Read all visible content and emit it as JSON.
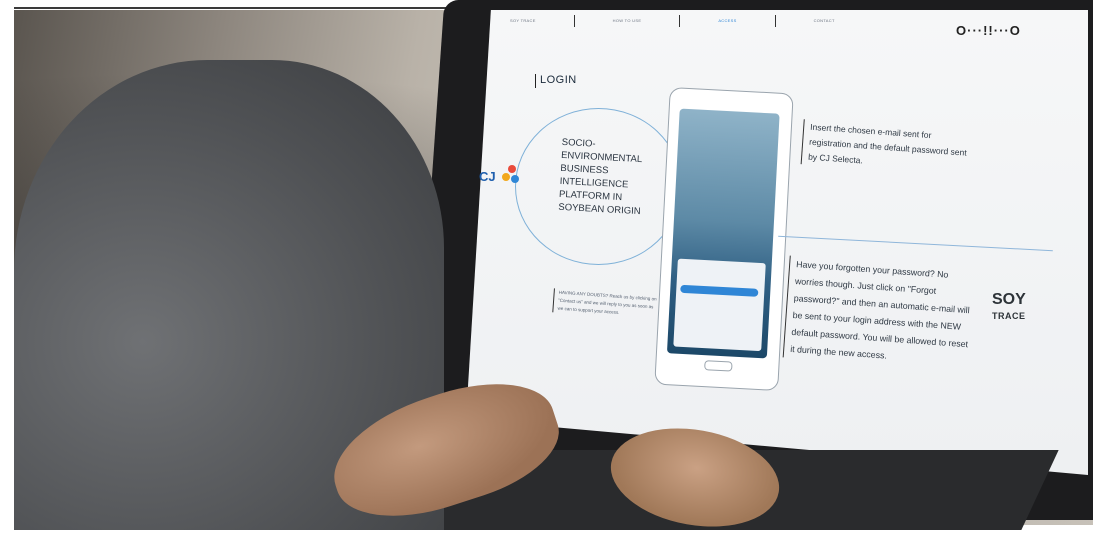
{
  "nav": {
    "items": [
      "SOY TRACE",
      "HOW TO USE",
      "ACCESS",
      "CONTACT"
    ]
  },
  "brand_top": "O···!!···O",
  "login_title": "LOGIN",
  "headline": "SOCIO-\nENVIRONMENTAL\nBUSINESS\nINTELLIGENCE\nPLATFORM IN\nSOYBEAN ORIGIN",
  "cj_logo_text": "CJ",
  "note_left": "HAVING ANY DOUBTS? Reach us by clicking on \"Contact us\" and we will reply to you as soon as we can to support your access.",
  "info1": "Insert the chosen e-mail sent for registration and the default password sent by CJ Selecta.",
  "info2": "Have you forgotten your password? No worries though. Just click on \"Forgot password?\" and then an automatic e-mail will be sent to your login address with the NEW default password. You will be allowed to reset it during the new access.",
  "soy_logo": {
    "main": "SOY",
    "sub": "TRACE"
  },
  "colors": {
    "accent_blue": "#2f86d6",
    "line_blue": "#8fb6da",
    "cj_blue": "#1f5fae"
  }
}
